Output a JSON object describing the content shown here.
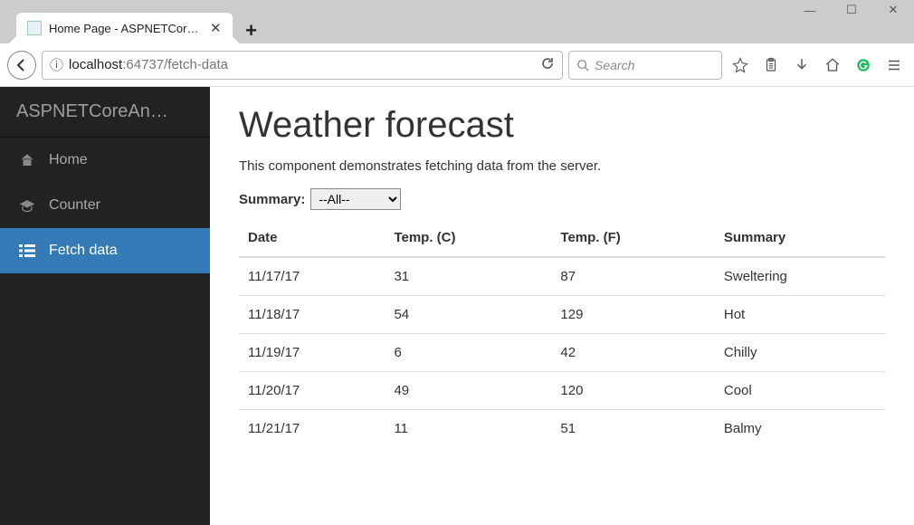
{
  "window": {
    "tab_title": "Home Page - ASPNETCoreAn"
  },
  "urlbar": {
    "info_icon": "ⓘ",
    "host": "localhost",
    "port": ":64737",
    "path": "/fetch-data"
  },
  "searchbar": {
    "placeholder": "Search"
  },
  "sidebar": {
    "brand": "ASPNETCoreAn…",
    "items": [
      {
        "label": "Home"
      },
      {
        "label": "Counter"
      },
      {
        "label": "Fetch data"
      }
    ],
    "active_index": 2
  },
  "page": {
    "title": "Weather forecast",
    "subtitle": "This component demonstrates fetching data from the server.",
    "filter_label": "Summary:",
    "filter_selected": "--All--",
    "columns": [
      "Date",
      "Temp. (C)",
      "Temp. (F)",
      "Summary"
    ],
    "rows": [
      {
        "date": "11/17/17",
        "c": "31",
        "f": "87",
        "summary": "Sweltering"
      },
      {
        "date": "11/18/17",
        "c": "54",
        "f": "129",
        "summary": "Hot"
      },
      {
        "date": "11/19/17",
        "c": "6",
        "f": "42",
        "summary": "Chilly"
      },
      {
        "date": "11/20/17",
        "c": "49",
        "f": "120",
        "summary": "Cool"
      },
      {
        "date": "11/21/17",
        "c": "11",
        "f": "51",
        "summary": "Balmy"
      }
    ]
  }
}
